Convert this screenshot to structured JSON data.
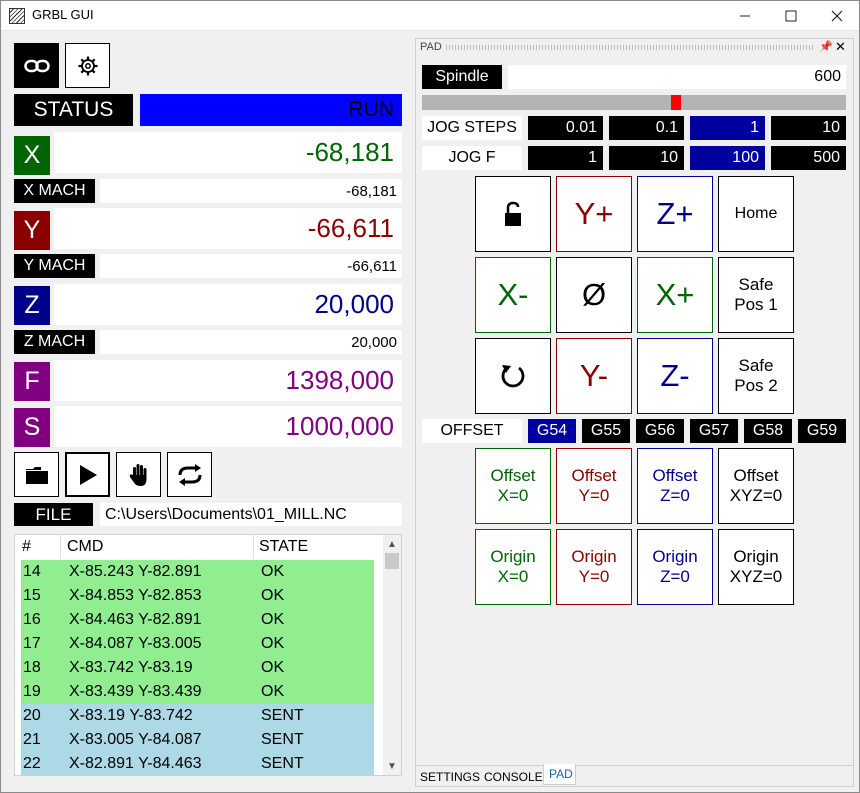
{
  "window": {
    "title": "GRBL GUI"
  },
  "status": {
    "label": "STATUS",
    "value": "RUN"
  },
  "axes": {
    "x": {
      "letter": "X",
      "value": "-68,181",
      "mach_label": "X MACH",
      "mach_value": "-68,181"
    },
    "y": {
      "letter": "Y",
      "value": "-66,611",
      "mach_label": "Y MACH",
      "mach_value": "-66,611"
    },
    "z": {
      "letter": "Z",
      "value": "20,000",
      "mach_label": "Z MACH",
      "mach_value": "20,000"
    },
    "f": {
      "letter": "F",
      "value": "1398,000"
    },
    "s": {
      "letter": "S",
      "value": "1000,000"
    }
  },
  "colors": {
    "x": "#006400",
    "y": "#8b0000",
    "z": "#00008b",
    "fs": "#800080",
    "run": "#0000ff",
    "ok_row": "#90ee90",
    "sent_row": "#add8e6"
  },
  "file": {
    "label": "FILE",
    "path": "C:\\Users\\Documents\\01_MILL.NC"
  },
  "grid": {
    "headers": [
      "#",
      "CMD",
      "STATE"
    ],
    "rows": [
      [
        "14",
        "X-85.243 Y-82.891",
        "OK"
      ],
      [
        "15",
        "X-84.853 Y-82.853",
        "OK"
      ],
      [
        "16",
        "X-84.463 Y-82.891",
        "OK"
      ],
      [
        "17",
        "X-84.087 Y-83.005",
        "OK"
      ],
      [
        "18",
        "X-83.742 Y-83.19",
        "OK"
      ],
      [
        "19",
        "X-83.439 Y-83.439",
        "OK"
      ],
      [
        "20",
        "X-83.19 Y-83.742",
        "SENT"
      ],
      [
        "21",
        "X-83.005 Y-84.087",
        "SENT"
      ],
      [
        "22",
        "X-82.891 Y-84.463",
        "SENT"
      ]
    ]
  },
  "pad": {
    "title": "PAD",
    "spindle": {
      "label": "Spindle",
      "value": "600",
      "slider_fraction": 0.6
    },
    "jog_steps": {
      "label": "JOG STEPS",
      "values": [
        "0.01",
        "0.1",
        "1",
        "10"
      ],
      "selected": 2
    },
    "jog_f": {
      "label": "JOG F",
      "values": [
        "1",
        "10",
        "100",
        "500"
      ],
      "selected": 2
    },
    "buttons": {
      "yplus": "Y+",
      "zplus": "Z+",
      "home": "Home",
      "xminus": "X-",
      "zero": "Ø",
      "xplus": "X+",
      "safe1_a": "Safe",
      "safe1_b": "Pos 1",
      "yminus": "Y-",
      "zminus": "Z-",
      "safe2_a": "Safe",
      "safe2_b": "Pos 2"
    },
    "offset": {
      "label": "OFFSET",
      "items": [
        "G54",
        "G55",
        "G56",
        "G57",
        "G58",
        "G59"
      ],
      "selected": 0
    },
    "offset_buttons": {
      "ox_a": "Offset",
      "ox_b": "X=0",
      "oy_a": "Offset",
      "oy_b": "Y=0",
      "oz_a": "Offset",
      "oz_b": "Z=0",
      "oxyz_a": "Offset",
      "oxyz_b": "XYZ=0",
      "gx_a": "Origin",
      "gx_b": "X=0",
      "gy_a": "Origin",
      "gy_b": "Y=0",
      "gz_a": "Origin",
      "gz_b": "Z=0",
      "gxyz_a": "Origin",
      "gxyz_b": "XYZ=0"
    }
  },
  "tabs": [
    "SETTINGS",
    "CONSOLE",
    "PAD"
  ],
  "icons": {
    "toolbar": [
      "link-icon",
      "gear-icon"
    ],
    "actions": [
      "folder-icon",
      "play-icon",
      "hand-stop-icon",
      "refresh-icon"
    ],
    "pad": [
      "unlock-icon",
      "reset-icon"
    ]
  }
}
